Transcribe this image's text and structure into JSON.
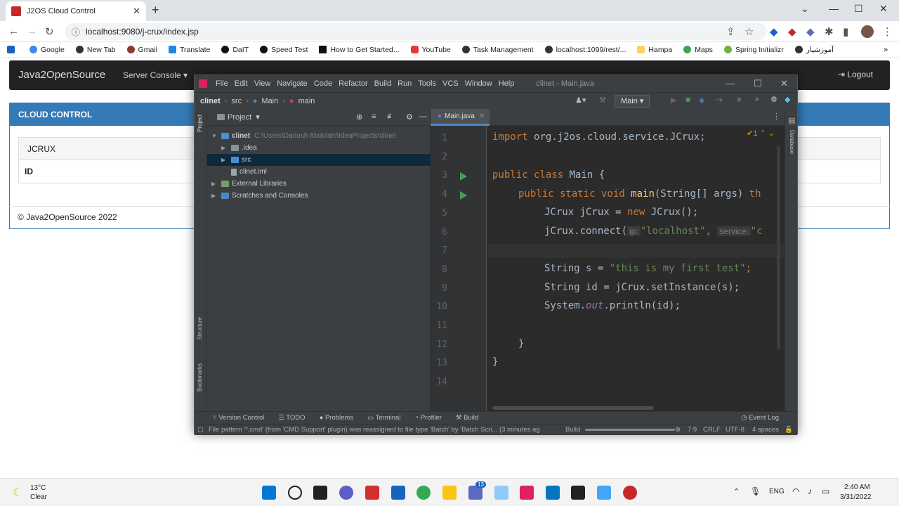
{
  "browser": {
    "tab_title": "J2OS Cloud Control",
    "url": "localhost:9080/j-crux/index.jsp",
    "bookmarks": [
      "Google",
      "New Tab",
      "Gmail",
      "Translate",
      "DaIT",
      "Speed Test",
      "How to Get Started...",
      "YouTube",
      "Task Management",
      "localhost:1099/rest/...",
      "Hampa",
      "Maps",
      "Spring Initializr",
      "آموزشیار"
    ]
  },
  "site": {
    "brand": "Java2OpenSource",
    "nav_server": "Server Console ▾",
    "logout": "Logout",
    "panel_title": "CLOUD CONTROL",
    "jcrux_title": "JCRUX",
    "id_label": "ID",
    "footer": "© Java2OpenSource 2022"
  },
  "ide": {
    "menu": [
      "File",
      "Edit",
      "View",
      "Navigate",
      "Code",
      "Refactor",
      "Build",
      "Run",
      "Tools",
      "VCS",
      "Window",
      "Help"
    ],
    "title": "clinet - Main.java",
    "breadcrumbs": [
      "clinet",
      "src",
      "Main",
      "main"
    ],
    "run_config": "Main",
    "project_label": "Project",
    "tree": {
      "root": "clinet",
      "root_path": "C:\\Users\\Dariush Abdolahi\\IdeaProjects\\clinet",
      "idea": ".idea",
      "src": "src",
      "iml": "clinet.iml",
      "ext": "External Libraries",
      "scratch": "Scratches and Consoles"
    },
    "editor_tab": "Main.java",
    "side_tabs": {
      "project": "Project",
      "structure": "Structure",
      "bookmarks": "Bookmarks",
      "database": "Database"
    },
    "warning_count": "1",
    "code": {
      "l1_kw": "import ",
      "l1_rest": "org.j2os.cloud.service.JCrux;",
      "l3_kw": "public class ",
      "l3_rest": "Main {",
      "l4_kw": "public static void ",
      "l4_fn": "main",
      "l4_rest": "(String[] args) ",
      "l4_tail": "th",
      "l5_a": "JCrux jCrux = ",
      "l5_kw": "new ",
      "l5_b": "JCrux();",
      "l6_a": "jCrux.connect(",
      "l6_hint1": "ip:",
      "l6_str": "\"localhost\"",
      "l6_comma": ",",
      "l6_hint2": "service:",
      "l6_tail": "\"c",
      "l8_a": "String s = ",
      "l8_str": "\"this is my first test\"",
      "l8_b": ";",
      "l9": "String id = jCrux.setInstance(s);",
      "l10_a": "System.",
      "l10_out": "out",
      "l10_b": ".println(id);",
      "l12": "}",
      "l13": "}"
    },
    "line_numbers": [
      "1",
      "2",
      "3",
      "4",
      "5",
      "6",
      "7",
      "8",
      "9",
      "10",
      "11",
      "12",
      "13",
      "14"
    ],
    "tool_windows": [
      "Version Control",
      "TODO",
      "Problems",
      "Terminal",
      "Profiler",
      "Build"
    ],
    "event_log": "Event Log",
    "status_msg": "File pattern '*.cmd' (from 'CMD Support' plugin) was reassigned to file type 'Batch' by 'Batch Scri... (3 minutes ag",
    "status_build": "Build",
    "status_pos": "7:9",
    "status_crlf": "CRLF",
    "status_enc": "UTF-8",
    "status_indent": "4 spaces"
  },
  "taskbar": {
    "temp": "13°C",
    "weather": "Clear",
    "lang": "ENG",
    "time": "2:40 AM",
    "date": "3/31/2022",
    "chat_badge": "13"
  }
}
